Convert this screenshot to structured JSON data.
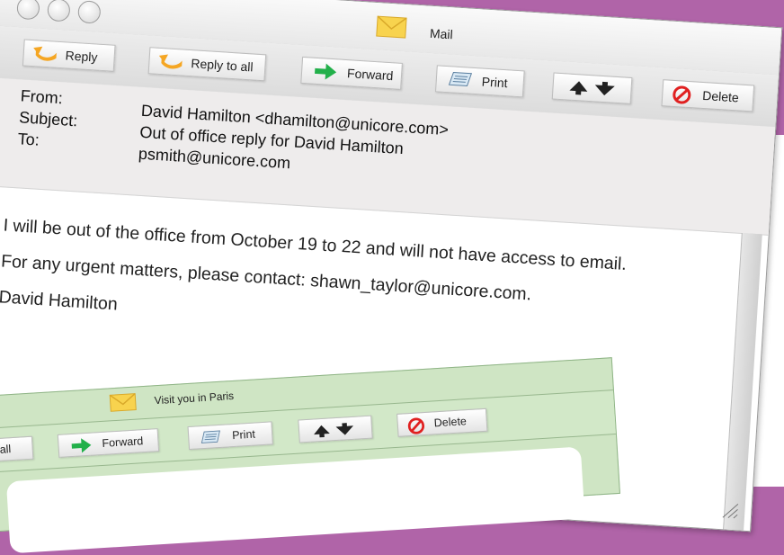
{
  "window": {
    "title": "Mail",
    "icon": "envelope-icon",
    "controls": [
      "close-control",
      "minimize-control",
      "zoom-control"
    ]
  },
  "toolbar": {
    "reply_label": "Reply",
    "reply_all_label": "Reply to all",
    "forward_label": "Forward",
    "print_label": "Print",
    "delete_label": "Delete"
  },
  "message": {
    "from_label": "From:",
    "subject_label": "Subject:",
    "to_label": "To:",
    "from_value": "David Hamilton  <dhamilton@unicore.com>",
    "subject_value": "Out of office reply for David Hamilton",
    "to_value": "psmith@unicore.com",
    "body": [
      "I will be out of the office from October 19 to 22 and will not have access to email.",
      "For any urgent matters, please contact: shawn_taylor@unicore.com.",
      "David Hamilton"
    ]
  },
  "second_window": {
    "title": "Visit you in Paris",
    "reply_all_partial": "all",
    "forward_label": "Forward",
    "print_label": "Print",
    "delete_label": "Delete"
  },
  "colors": {
    "background": "#b064a8",
    "forward_arrow": "#22b04a",
    "delete_icon": "#e02020",
    "reply_arrow": "#f5a623",
    "envelope": "#f8d34e",
    "second_window_bg": "#cfe5c4"
  }
}
